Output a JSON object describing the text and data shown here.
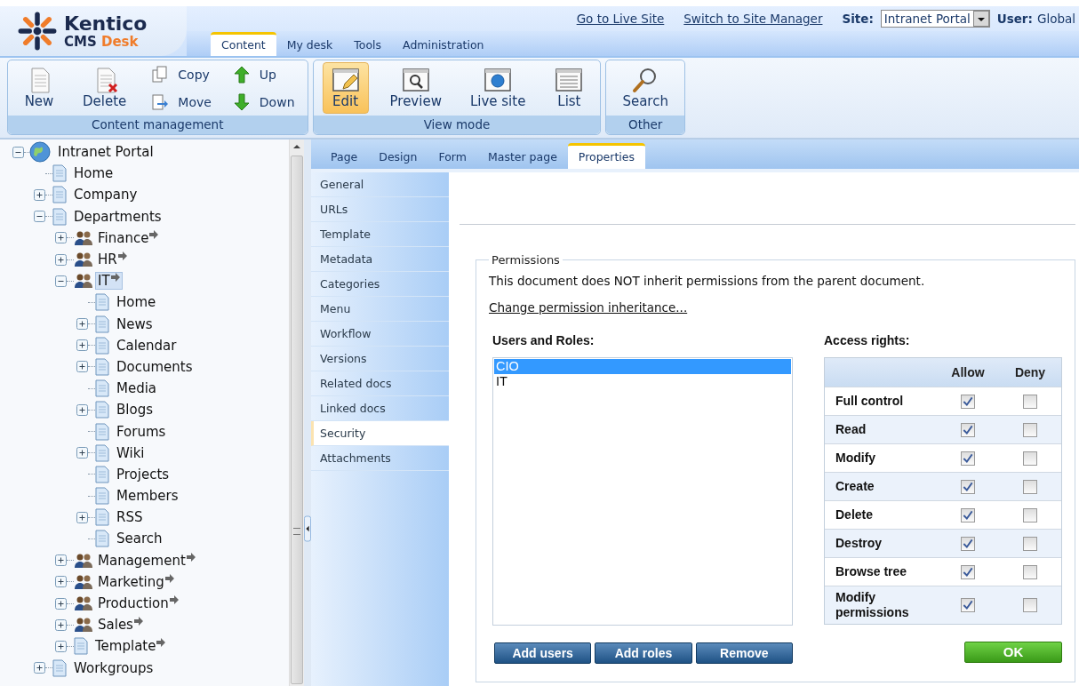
{
  "header": {
    "logo": {
      "title": "Kentico",
      "product": "CMS",
      "edition": "Desk"
    },
    "links": [
      "Go to Live Site",
      "Switch to Site Manager"
    ],
    "site": {
      "label": "Site:",
      "value": "Intranet Portal"
    },
    "user": {
      "label": "User:",
      "value": "Global"
    },
    "tabs": [
      {
        "label": "Content",
        "selected": true
      },
      {
        "label": "My desk",
        "selected": false
      },
      {
        "label": "Tools",
        "selected": false
      },
      {
        "label": "Administration",
        "selected": false
      }
    ]
  },
  "toolbar": [
    {
      "title": "Content management",
      "items": [
        {
          "label": "New",
          "kind": "large",
          "selected": false
        },
        {
          "label": "Delete",
          "kind": "large",
          "selected": false
        },
        {
          "label": "Copy",
          "kind": "small",
          "selected": false
        },
        {
          "label": "Move",
          "kind": "small",
          "selected": false
        },
        {
          "label": "Up",
          "kind": "small",
          "selected": false
        },
        {
          "label": "Down",
          "kind": "small",
          "selected": false
        }
      ]
    },
    {
      "title": "View mode",
      "items": [
        {
          "label": "Edit",
          "kind": "large",
          "selected": true
        },
        {
          "label": "Preview",
          "kind": "large",
          "selected": false
        },
        {
          "label": "Live site",
          "kind": "large",
          "selected": false
        },
        {
          "label": "List",
          "kind": "large",
          "selected": false
        }
      ]
    },
    {
      "title": "Other",
      "items": [
        {
          "label": "Search",
          "kind": "large",
          "selected": false
        }
      ]
    }
  ],
  "tree": [
    {
      "label": "Intranet Portal",
      "kind": "site",
      "expandable": true,
      "expanded": true,
      "linked": false,
      "selected": false,
      "children": [
        {
          "label": "Home",
          "kind": "page",
          "expandable": false,
          "linked": false,
          "selected": false
        },
        {
          "label": "Company",
          "kind": "page",
          "expandable": true,
          "expanded": false,
          "linked": false,
          "selected": false
        },
        {
          "label": "Departments",
          "kind": "page",
          "expandable": true,
          "expanded": true,
          "linked": false,
          "selected": false,
          "children": [
            {
              "label": "Finance",
              "kind": "group",
              "expandable": true,
              "expanded": false,
              "linked": true,
              "selected": false
            },
            {
              "label": "HR",
              "kind": "group",
              "expandable": true,
              "expanded": false,
              "linked": true,
              "selected": false
            },
            {
              "label": "IT",
              "kind": "group",
              "expandable": true,
              "expanded": true,
              "linked": true,
              "selected": true,
              "children": [
                {
                  "label": "Home",
                  "kind": "page",
                  "expandable": false,
                  "linked": false,
                  "selected": false
                },
                {
                  "label": "News",
                  "kind": "page",
                  "expandable": true,
                  "expanded": false,
                  "linked": false,
                  "selected": false
                },
                {
                  "label": "Calendar",
                  "kind": "page",
                  "expandable": true,
                  "expanded": false,
                  "linked": false,
                  "selected": false
                },
                {
                  "label": "Documents",
                  "kind": "page",
                  "expandable": true,
                  "expanded": false,
                  "linked": false,
                  "selected": false
                },
                {
                  "label": "Media",
                  "kind": "page",
                  "expandable": false,
                  "linked": false,
                  "selected": false
                },
                {
                  "label": "Blogs",
                  "kind": "page",
                  "expandable": true,
                  "expanded": false,
                  "linked": false,
                  "selected": false
                },
                {
                  "label": "Forums",
                  "kind": "page",
                  "expandable": false,
                  "linked": false,
                  "selected": false
                },
                {
                  "label": "Wiki",
                  "kind": "page",
                  "expandable": true,
                  "expanded": false,
                  "linked": false,
                  "selected": false
                },
                {
                  "label": "Projects",
                  "kind": "page",
                  "expandable": false,
                  "linked": false,
                  "selected": false
                },
                {
                  "label": "Members",
                  "kind": "page",
                  "expandable": false,
                  "linked": false,
                  "selected": false
                },
                {
                  "label": "RSS",
                  "kind": "page",
                  "expandable": true,
                  "expanded": false,
                  "linked": false,
                  "selected": false
                },
                {
                  "label": "Search",
                  "kind": "page",
                  "expandable": false,
                  "linked": false,
                  "selected": false
                }
              ]
            },
            {
              "label": "Management",
              "kind": "group",
              "expandable": true,
              "expanded": false,
              "linked": true,
              "selected": false
            },
            {
              "label": "Marketing",
              "kind": "group",
              "expandable": true,
              "expanded": false,
              "linked": true,
              "selected": false
            },
            {
              "label": "Production",
              "kind": "group",
              "expandable": true,
              "expanded": false,
              "linked": true,
              "selected": false
            },
            {
              "label": "Sales",
              "kind": "group",
              "expandable": true,
              "expanded": false,
              "linked": true,
              "selected": false
            },
            {
              "label": "Template",
              "kind": "page",
              "expandable": true,
              "expanded": false,
              "linked": true,
              "selected": false
            }
          ]
        },
        {
          "label": "Workgroups",
          "kind": "page",
          "expandable": true,
          "expanded": false,
          "linked": false,
          "selected": false
        }
      ]
    }
  ],
  "view_tabs": [
    {
      "label": "Page",
      "selected": false
    },
    {
      "label": "Design",
      "selected": false
    },
    {
      "label": "Form",
      "selected": false
    },
    {
      "label": "Master page",
      "selected": false
    },
    {
      "label": "Properties",
      "selected": true
    }
  ],
  "properties_menu": [
    {
      "label": "General",
      "selected": false
    },
    {
      "label": "URLs",
      "selected": false
    },
    {
      "label": "Template",
      "selected": false
    },
    {
      "label": "Metadata",
      "selected": false
    },
    {
      "label": "Categories",
      "selected": false
    },
    {
      "label": "Menu",
      "selected": false
    },
    {
      "label": "Workflow",
      "selected": false
    },
    {
      "label": "Versions",
      "selected": false
    },
    {
      "label": "Related docs",
      "selected": false
    },
    {
      "label": "Linked docs",
      "selected": false
    },
    {
      "label": "Security",
      "selected": true
    },
    {
      "label": "Attachments",
      "selected": false
    }
  ],
  "permissions": {
    "legend": "Permissions",
    "message": "This document does NOT inherit permissions from the parent document.",
    "link": "Change permission inheritance...",
    "users_label": "Users and Roles:",
    "users": [
      {
        "label": "CIO",
        "selected": true
      },
      {
        "label": "IT",
        "selected": false
      }
    ],
    "buttons": [
      "Add users",
      "Add roles",
      "Remove"
    ],
    "rights_label": "Access rights:",
    "columns": [
      "Allow",
      "Deny"
    ],
    "rights": [
      {
        "label": "Full control",
        "allow": true,
        "deny": false
      },
      {
        "label": "Read",
        "allow": true,
        "deny": false
      },
      {
        "label": "Modify",
        "allow": true,
        "deny": false
      },
      {
        "label": "Create",
        "allow": true,
        "deny": false
      },
      {
        "label": "Delete",
        "allow": true,
        "deny": false
      },
      {
        "label": "Destroy",
        "allow": true,
        "deny": false
      },
      {
        "label": "Browse tree",
        "allow": true,
        "deny": false
      },
      {
        "label": "Modify permissions",
        "allow": true,
        "deny": false
      }
    ],
    "ok": "OK"
  }
}
